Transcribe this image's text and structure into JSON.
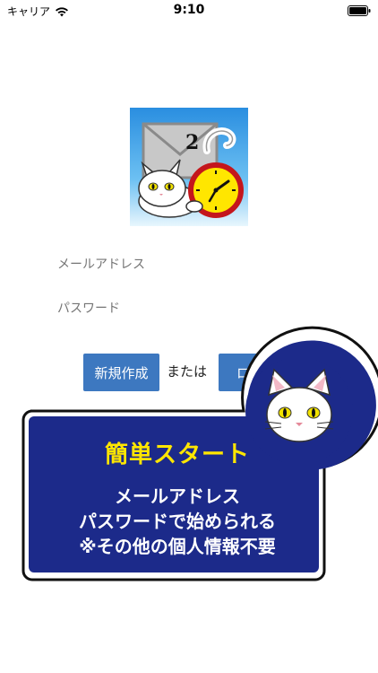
{
  "status_bar": {
    "carrier": "キャリア",
    "time": "9:10"
  },
  "app_icon": {
    "badge": "2",
    "name": "cat-clock-mail-icon"
  },
  "form": {
    "email_placeholder": "メールアドレス",
    "password_placeholder": "パスワード",
    "signup_label": "新規作成",
    "or_label": "または",
    "login_label": "ログ"
  },
  "promo": {
    "title": "簡単スタート",
    "line1": "メールアドレス",
    "line2": "パスワードで始められる",
    "line3": "※その他の個人情報不要"
  },
  "colors": {
    "button_blue": "#3d78c0",
    "promo_navy": "#1c2a8a",
    "promo_title_yellow": "#ffe600",
    "icon_bg": "#3aa0e8"
  }
}
